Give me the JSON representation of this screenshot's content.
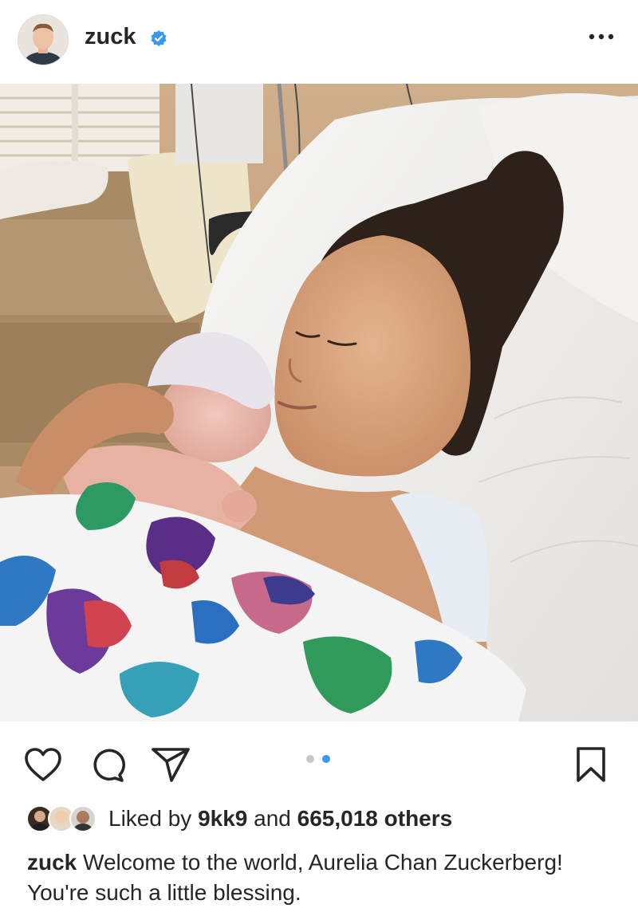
{
  "post": {
    "username": "zuck",
    "verified": true,
    "more_icon": "more-horizontal-icon"
  },
  "media": {
    "carousel_total": 2,
    "carousel_active": 2
  },
  "actions": {
    "like_icon": "heart-icon",
    "comment_icon": "comment-icon",
    "share_icon": "send-icon",
    "save_icon": "bookmark-icon"
  },
  "likes": {
    "prefix": "Liked by",
    "first_user": "9kk9",
    "joiner": "and",
    "others": "665,018 others"
  },
  "caption": {
    "username": "zuck",
    "text": "Welcome to the world, Aurelia Chan Zuckerberg! You're such a little blessing."
  },
  "colors": {
    "verified_blue": "#3897f0",
    "active_dot": "#3897f0",
    "inactive_dot": "#c7c7c7",
    "text": "#262626"
  }
}
